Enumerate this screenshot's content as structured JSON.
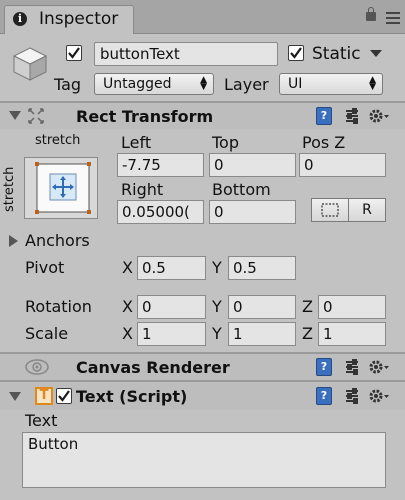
{
  "tab": {
    "title": "Inspector",
    "info_glyph": "i"
  },
  "header": {
    "object_name": "buttonText",
    "static_label": "Static",
    "tag_label": "Tag",
    "tag_value": "Untagged",
    "layer_label": "Layer",
    "layer_value": "UI"
  },
  "rect_transform": {
    "title": "Rect Transform",
    "preset_top": "stretch",
    "preset_side": "stretch",
    "left_label": "Left",
    "left_value": "-7.75",
    "top_label": "Top",
    "top_value": "0",
    "posz_label": "Pos Z",
    "posz_value": "0",
    "right_label": "Right",
    "right_value": "0.05000(",
    "bottom_label": "Bottom",
    "bottom_value": "0",
    "r_button": "R",
    "anchors_label": "Anchors",
    "pivot_label": "Pivot",
    "pivot_x": "0.5",
    "pivot_y": "0.5",
    "rotation_label": "Rotation",
    "rot_x": "0",
    "rot_y": "0",
    "rot_z": "0",
    "scale_label": "Scale",
    "scale_x": "1",
    "scale_y": "1",
    "scale_z": "1",
    "axis_x": "X",
    "axis_y": "Y",
    "axis_z": "Z"
  },
  "canvas_renderer": {
    "title": "Canvas Renderer"
  },
  "text_script": {
    "title": "Text (Script)",
    "text_label": "Text",
    "text_value": "Button",
    "icon_glyph": "T"
  },
  "colors": {
    "accent_orange": "#e08a1e",
    "help_blue": "#3a6fbf"
  }
}
